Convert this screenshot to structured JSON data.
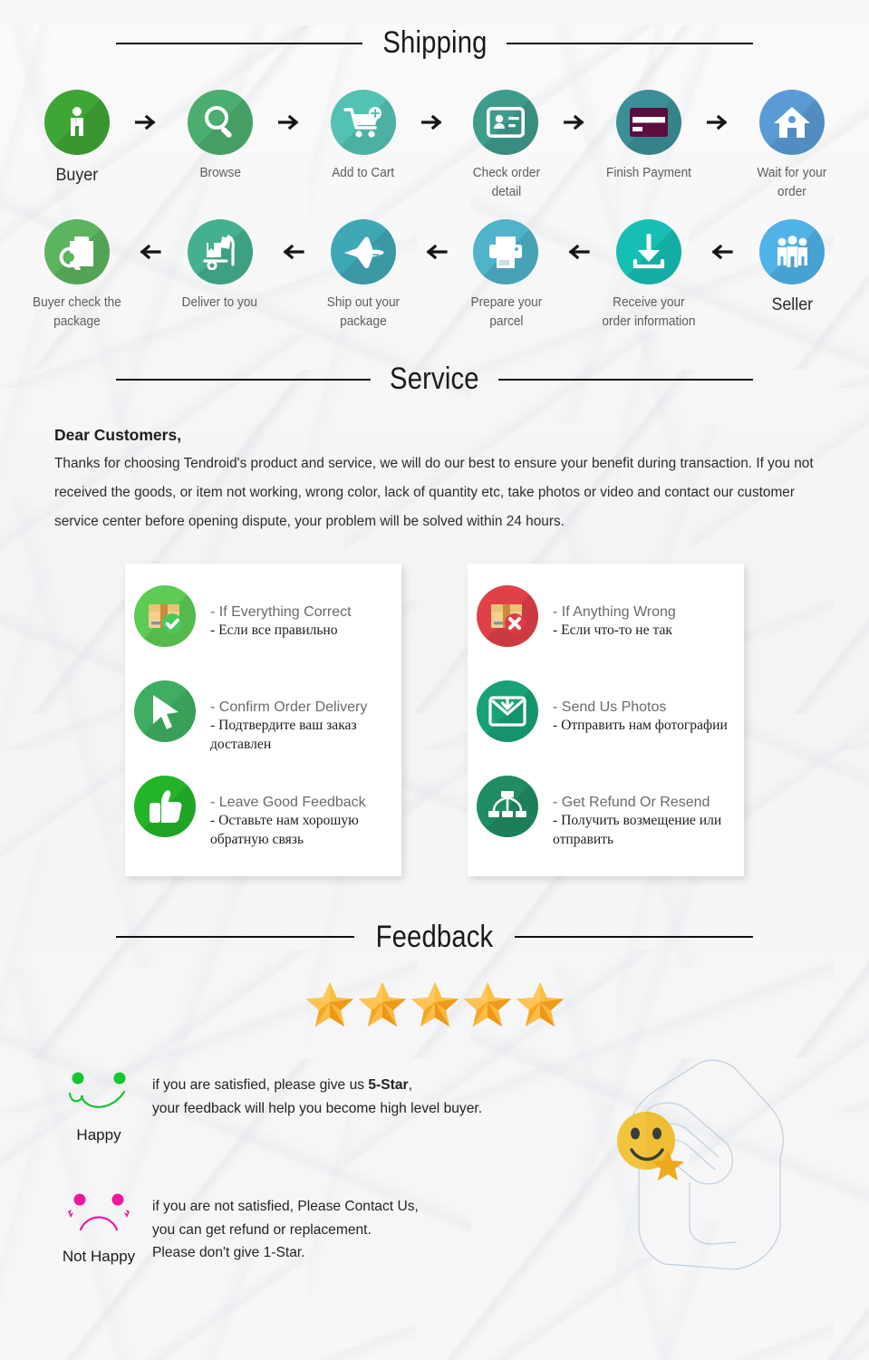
{
  "sections": {
    "shipping_title": "Shipping",
    "service_title": "Service",
    "feedback_title": "Feedback"
  },
  "colors": {
    "rule": "#111111",
    "buyer": "#3FA535",
    "browse": "#4CAE6E",
    "cart": "#54C2B2",
    "check_order": "#3E9C8D",
    "payment": "#3C8F96",
    "wait": "#5B9BD5",
    "buyer_check": "#5CB45F",
    "deliver": "#45B08F",
    "ship_out": "#3FA8B5",
    "prepare": "#4FB3C9",
    "receive": "#16BFB4",
    "seller": "#4FB3E8",
    "correct": "#5ECB54",
    "confirm": "#3FAE62",
    "feedback_thumb": "#23B42A",
    "wrong": "#E04048",
    "photos": "#18A178",
    "refund": "#1F8C63",
    "star": "#F9A825",
    "happy": "#17C431",
    "not_happy": "#F0179B"
  },
  "shipping": {
    "row1": [
      {
        "label": "Buyer",
        "icon": "person-icon",
        "color_key": "buyer",
        "emphasis": true
      },
      {
        "label": "Browse",
        "icon": "magnifier-icon",
        "color_key": "browse",
        "emphasis": false
      },
      {
        "label": "Add to Cart",
        "icon": "shopping-cart-icon",
        "color_key": "cart",
        "emphasis": false
      },
      {
        "label": "Check order detail",
        "icon": "id-card-icon",
        "color_key": "check_order",
        "emphasis": false
      },
      {
        "label": "Finish Payment",
        "icon": "credit-card-icon",
        "color_key": "payment",
        "emphasis": false
      },
      {
        "label": "Wait for your order",
        "icon": "house-icon",
        "color_key": "wait",
        "emphasis": false
      }
    ],
    "row2": [
      {
        "label": "Buyer check the package",
        "icon": "package-inspect-icon",
        "color_key": "buyer_check",
        "emphasis": false
      },
      {
        "label": "Deliver to you",
        "icon": "hand-truck-icon",
        "color_key": "deliver",
        "emphasis": false
      },
      {
        "label": "Ship out your package",
        "icon": "airplane-icon",
        "color_key": "ship_out",
        "emphasis": false
      },
      {
        "label": "Prepare your parcel",
        "icon": "printer-icon",
        "color_key": "prepare",
        "emphasis": false
      },
      {
        "label": "Receive your order information",
        "icon": "download-icon",
        "color_key": "receive",
        "emphasis": false
      },
      {
        "label": "Seller",
        "icon": "people-group-icon",
        "color_key": "seller",
        "emphasis": true
      }
    ],
    "arrow_right": "→",
    "arrow_left": "←"
  },
  "service": {
    "greeting": "Dear Customers,",
    "body": "Thanks for choosing Tendroid's product and service, we will do our best to ensure your benefit during transaction. If you not received the goods, or item not working, wrong color, lack of quantity etc, take photos or video and contact our customer service center before opening dispute, your problem will be solved within 24 hours.",
    "left_card": [
      {
        "icon": "box-check-icon",
        "color_key": "correct",
        "en": "- If Everything Correct",
        "ru": "- Если все правильно"
      },
      {
        "icon": "cursor-arrow-icon",
        "color_key": "confirm",
        "en": "- Confirm Order Delivery",
        "ru": "- Подтвердите ваш заказ доставлен"
      },
      {
        "icon": "thumbs-up-icon",
        "color_key": "feedback_thumb",
        "en": "- Leave Good Feedback",
        "ru": "- Оставьте нам хорошую обратную связь"
      }
    ],
    "right_card": [
      {
        "icon": "box-cross-icon",
        "color_key": "wrong",
        "en": "- If Anything Wrong",
        "ru": "- Если что-то не так"
      },
      {
        "icon": "envelope-download-icon",
        "color_key": "photos",
        "en": "- Send Us Photos",
        "ru": "- Отправить нам фотографии"
      },
      {
        "icon": "sitemap-icon",
        "color_key": "refund",
        "en": "- Get Refund Or Resend",
        "ru": "- Получить возмещение или отправить"
      }
    ]
  },
  "feedback": {
    "star_count": 5,
    "star_icon": "star-icon",
    "happy": {
      "face_icon": "happy-face-icon",
      "label": "Happy",
      "line1_pre": "if you are satisfied, please give us ",
      "line1_strong": "5-Star",
      "line1_post": ",",
      "line2": "your feedback will help you become high level buyer."
    },
    "not_happy": {
      "face_icon": "sad-face-icon",
      "label": "Not Happy",
      "line1": "if you are not satisfied, Please Contact Us,",
      "line2": "you can get refund or replacement.",
      "line3": "Please don't give 1-Star."
    },
    "hand_art_icon": "hand-holding-smiley-icon"
  }
}
